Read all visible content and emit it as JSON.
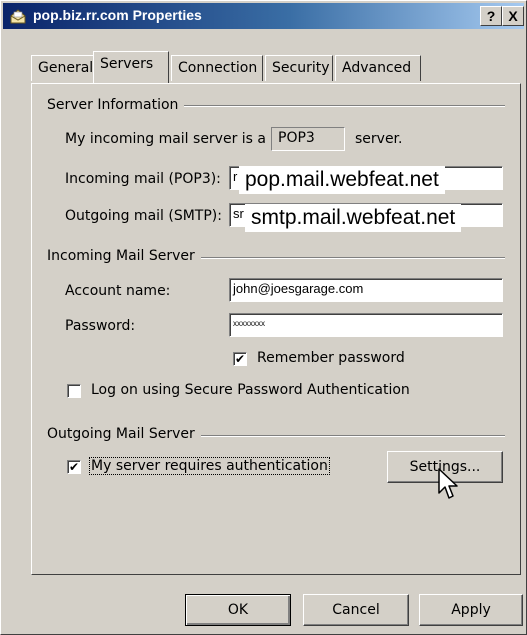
{
  "window": {
    "title": "pop.biz.rr.com Properties",
    "help_label": "?",
    "close_label": "X"
  },
  "tabs": [
    {
      "label": "General"
    },
    {
      "label": "Servers",
      "active": true
    },
    {
      "label": "Connection"
    },
    {
      "label": "Security"
    },
    {
      "label": "Advanced"
    }
  ],
  "server_info": {
    "section_label": "Server Information",
    "incoming_type_prefix": "My incoming mail server is a",
    "incoming_type_value": "POP3",
    "incoming_type_suffix": "server.",
    "incoming_label": "Incoming mail (POP3):",
    "incoming_field_value": "r",
    "incoming_overlay": "pop.mail.webfeat.net",
    "outgoing_label": "Outgoing mail (SMTP):",
    "outgoing_field_value": "sr",
    "outgoing_overlay": "smtp.mail.webfeat.net"
  },
  "incoming_server": {
    "section_label": "Incoming Mail Server",
    "account_label": "Account name:",
    "account_value": "john@joesgarage.com",
    "password_label": "Password:",
    "password_value": "xxxxxxxx",
    "remember_label": "Remember password",
    "remember_checked": true,
    "spa_label": "Log on using Secure Password Authentication",
    "spa_checked": false
  },
  "outgoing_server": {
    "section_label": "Outgoing Mail Server",
    "auth_label": "My server requires authentication",
    "auth_checked": true,
    "settings_label": "Settings..."
  },
  "buttons": {
    "ok": "OK",
    "cancel": "Cancel",
    "apply": "Apply"
  },
  "check_glyph": "✔"
}
